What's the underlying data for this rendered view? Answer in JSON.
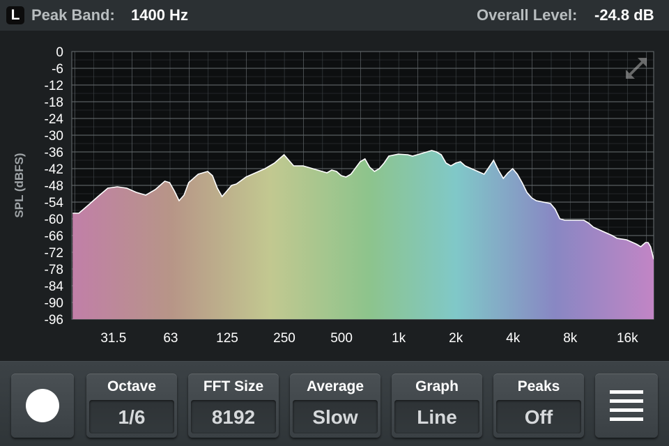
{
  "header": {
    "channel": "L",
    "peak_label": "Peak Band:",
    "peak_value": "1400 Hz",
    "level_label": "Overall Level:",
    "level_value": "-24.8 dB"
  },
  "chart_data": {
    "type": "area",
    "ylabel": "SPL (dBFS)",
    "ylim": [
      -96,
      0
    ],
    "yticks": [
      0,
      -6,
      -12,
      -18,
      -24,
      -30,
      -36,
      -42,
      -48,
      -54,
      -60,
      -66,
      -72,
      -78,
      -84,
      -90,
      -96
    ],
    "x_scale": "log",
    "xlim_hz": [
      19,
      22000
    ],
    "xticks": [
      {
        "label": "31.5",
        "hz": 31.5
      },
      {
        "label": "63",
        "hz": 63
      },
      {
        "label": "125",
        "hz": 125
      },
      {
        "label": "250",
        "hz": 250
      },
      {
        "label": "500",
        "hz": 500
      },
      {
        "label": "1k",
        "hz": 1000
      },
      {
        "label": "2k",
        "hz": 2000
      },
      {
        "label": "4k",
        "hz": 4000
      },
      {
        "label": "8k",
        "hz": 8000
      },
      {
        "label": "16k",
        "hz": 16000
      }
    ],
    "grid": true,
    "fill": "spectrum-gradient",
    "points": [
      [
        19.2,
        -58
      ],
      [
        20.7,
        -58
      ],
      [
        23.3,
        -55
      ],
      [
        26.1,
        -52
      ],
      [
        29.4,
        -49
      ],
      [
        33,
        -48.5
      ],
      [
        37,
        -49
      ],
      [
        41.5,
        -50.5
      ],
      [
        46.6,
        -51.5
      ],
      [
        52.3,
        -49.5
      ],
      [
        58.7,
        -46.5
      ],
      [
        62.2,
        -47
      ],
      [
        65.9,
        -50
      ],
      [
        69.8,
        -53.5
      ],
      [
        74.1,
        -51.5
      ],
      [
        78.4,
        -47
      ],
      [
        88,
        -44
      ],
      [
        98.7,
        -43
      ],
      [
        104.6,
        -44.5
      ],
      [
        111,
        -49
      ],
      [
        117.5,
        -52
      ],
      [
        124.6,
        -50
      ],
      [
        132,
        -48
      ],
      [
        139.8,
        -47.5
      ],
      [
        157,
        -45
      ],
      [
        176.2,
        -43.5
      ],
      [
        197.8,
        -42
      ],
      [
        221.8,
        -40
      ],
      [
        235,
        -38.5
      ],
      [
        249,
        -37
      ],
      [
        264,
        -39
      ],
      [
        280,
        -41
      ],
      [
        314,
        -41
      ],
      [
        352.5,
        -42
      ],
      [
        395.6,
        -43
      ],
      [
        419,
        -43.5
      ],
      [
        444,
        -42.5
      ],
      [
        470.4,
        -43
      ],
      [
        498,
        -44.5
      ],
      [
        528,
        -45
      ],
      [
        560,
        -44
      ],
      [
        627,
        -39.5
      ],
      [
        664,
        -38.5
      ],
      [
        704,
        -41.5
      ],
      [
        746,
        -43
      ],
      [
        790,
        -42
      ],
      [
        837,
        -40
      ],
      [
        887,
        -37.5
      ],
      [
        994,
        -36.8
      ],
      [
        1116,
        -37
      ],
      [
        1183,
        -37.5
      ],
      [
        1253,
        -37
      ],
      [
        1406,
        -36
      ],
      [
        1492,
        -35.5
      ],
      [
        1582,
        -36
      ],
      [
        1676,
        -37
      ],
      [
        1776,
        -40
      ],
      [
        1882,
        -41
      ],
      [
        1993,
        -40
      ],
      [
        2113,
        -39.5
      ],
      [
        2236,
        -41
      ],
      [
        2511,
        -42.5
      ],
      [
        2817,
        -44
      ],
      [
        2985,
        -41.5
      ],
      [
        3160,
        -39
      ],
      [
        3350,
        -42.5
      ],
      [
        3552,
        -45.5
      ],
      [
        3760,
        -43.5
      ],
      [
        3982,
        -42
      ],
      [
        4216,
        -44
      ],
      [
        4464,
        -47
      ],
      [
        4733,
        -50.5
      ],
      [
        5014,
        -52.5
      ],
      [
        5310,
        -53.5
      ],
      [
        6290,
        -54.5
      ],
      [
        6661,
        -56.5
      ],
      [
        7056,
        -60
      ],
      [
        7477,
        -60.5
      ],
      [
        8398,
        -60.5
      ],
      [
        9436,
        -60.5
      ],
      [
        9998,
        -61.5
      ],
      [
        10595,
        -63
      ],
      [
        11871,
        -64.5
      ],
      [
        13316,
        -66
      ],
      [
        14107,
        -67
      ],
      [
        15829,
        -67.5
      ],
      [
        17756,
        -69
      ],
      [
        18819,
        -70
      ],
      [
        19931,
        -68.5
      ],
      [
        20558,
        -68.5
      ],
      [
        21196,
        -70
      ],
      [
        22000,
        -74.5
      ]
    ]
  },
  "controls": {
    "record_label": "record",
    "octave": {
      "label": "Octave",
      "value": "1/6"
    },
    "fft": {
      "label": "FFT Size",
      "value": "8192"
    },
    "average": {
      "label": "Average",
      "value": "Slow"
    },
    "graph": {
      "label": "Graph",
      "value": "Line"
    },
    "peaks": {
      "label": "Peaks",
      "value": "Off"
    }
  },
  "colors": {
    "gradient": [
      "#c17fa8",
      "#b79587",
      "#c2c890",
      "#8dc48c",
      "#80c8c8",
      "#8887c3",
      "#c285c5"
    ]
  },
  "icons": [
    "record-icon",
    "expand-icon",
    "menu-icon"
  ]
}
